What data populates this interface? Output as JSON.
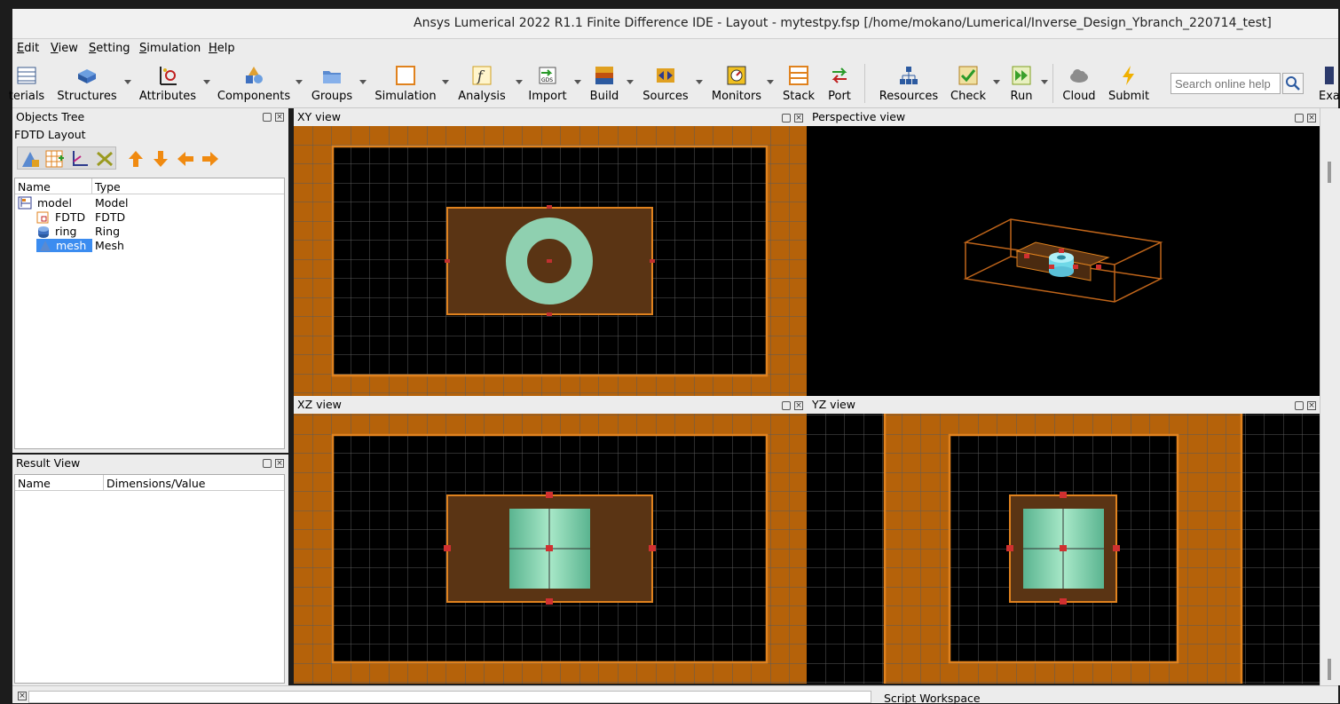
{
  "window": {
    "title": "Ansys Lumerical 2022 R1.1 Finite Difference IDE - Layout - mytestpy.fsp [/home/mokano/Lumerical/Inverse_Design_Ybranch_220714_test]"
  },
  "menu": {
    "items": [
      "Edit",
      "View",
      "Setting",
      "Simulation",
      "Help"
    ]
  },
  "toolbar": {
    "buttons": [
      {
        "label": "terials",
        "icon": "materials-icon"
      },
      {
        "label": "Structures",
        "icon": "cube-icon"
      },
      {
        "label": "Attributes",
        "icon": "attributes-icon"
      },
      {
        "label": "Components",
        "icon": "components-icon"
      },
      {
        "label": "Groups",
        "icon": "folder-icon"
      },
      {
        "label": "Simulation",
        "icon": "simulation-region-icon"
      },
      {
        "label": "Analysis",
        "icon": "function-icon"
      },
      {
        "label": "Import",
        "icon": "gds-import-icon"
      },
      {
        "label": "Build",
        "icon": "build-icon"
      },
      {
        "label": "Sources",
        "icon": "source-icon"
      },
      {
        "label": "Monitors",
        "icon": "monitor-icon"
      },
      {
        "label": "Stack",
        "icon": "stack-icon"
      },
      {
        "label": "Port",
        "icon": "port-icon"
      },
      {
        "label": "Resources",
        "icon": "resources-icon"
      },
      {
        "label": "Check",
        "icon": "check-icon"
      },
      {
        "label": "Run",
        "icon": "run-icon"
      },
      {
        "label": "Cloud",
        "icon": "cloud-icon"
      },
      {
        "label": "Submit",
        "icon": "lightning-icon"
      },
      {
        "label": "Exa",
        "icon": "examples-icon"
      }
    ],
    "search_placeholder": "Search online help"
  },
  "objects_tree": {
    "title": "Objects Tree",
    "subtitle": "FDTD Layout",
    "columns": [
      "Name",
      "Type"
    ],
    "rows": [
      {
        "name": "model",
        "type": "Model",
        "icon": "model-icon"
      },
      {
        "name": "FDTD",
        "type": "FDTD",
        "icon": "fdtd-icon"
      },
      {
        "name": "ring",
        "type": "Ring",
        "icon": "ring-icon"
      },
      {
        "name": "mesh",
        "type": "Mesh",
        "icon": "mesh-icon",
        "selected": true
      }
    ]
  },
  "result_view": {
    "title": "Result View",
    "columns": [
      "Name",
      "Dimensions/Value"
    ]
  },
  "views": {
    "xy": "XY view",
    "perspective": "Perspective view",
    "xz": "XZ view",
    "yz": "YZ view"
  },
  "bottom": {
    "script_workspace": "Script Workspace"
  },
  "colors": {
    "pml_orange": "#b5620a",
    "region_outline": "#e0821e",
    "ring_green": "#8fd0b0",
    "selection_blue": "#3b8cf0"
  }
}
